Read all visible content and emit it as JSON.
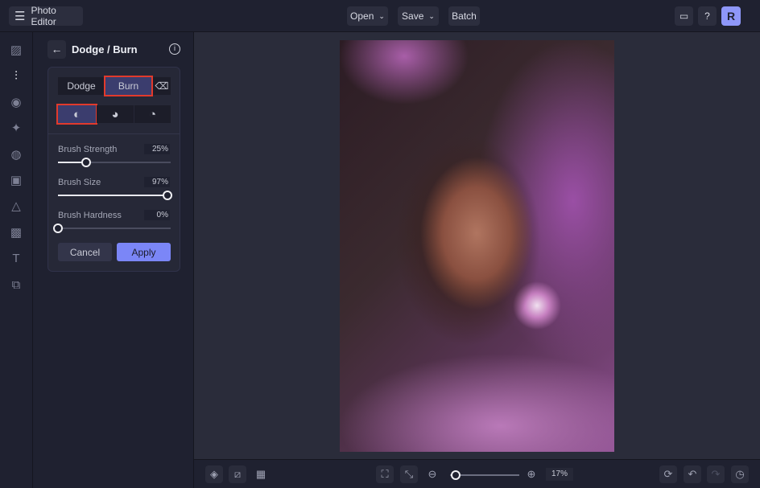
{
  "header": {
    "menu_icon": "hamburger-icon",
    "title": "Photo Editor",
    "open": "Open",
    "save": "Save",
    "batch": "Batch",
    "avatar": "R"
  },
  "rail": [
    "image-icon",
    "adjust-icon",
    "eye-icon",
    "sparkle-icon",
    "palette-icon",
    "frame-icon",
    "shapes-icon",
    "texture-icon",
    "text-icon",
    "overlay-icon"
  ],
  "panel": {
    "title": "Dodge / Burn",
    "tabs": [
      "Dodge",
      "Burn"
    ],
    "sliders": [
      {
        "label": "Brush Strength",
        "value": 25,
        "display": "25%"
      },
      {
        "label": "Brush Size",
        "value": 97,
        "display": "97%"
      },
      {
        "label": "Brush Hardness",
        "value": 0,
        "display": "0%"
      }
    ],
    "cancel": "Cancel",
    "apply": "Apply"
  },
  "bottom": {
    "zoom": "17%",
    "zoom_value": 17
  },
  "colors": {
    "accent": "#7b86f7",
    "highlight": "#e23a2c"
  }
}
